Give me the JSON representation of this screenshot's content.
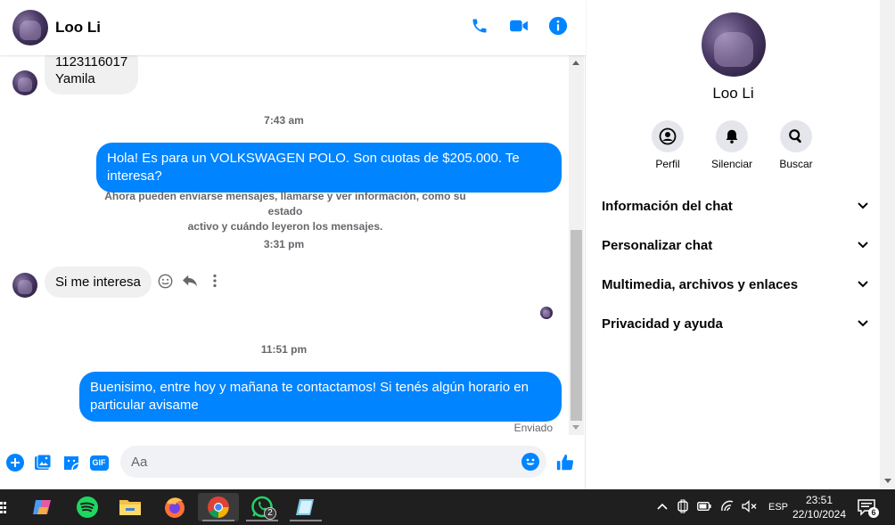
{
  "contact": {
    "name": "Loo Li"
  },
  "messages": {
    "incoming_top_line1": "1123116017",
    "incoming_top_line2": "Yamila",
    "ts1": "7:43 am",
    "outgoing1": "Hola! Es para un VOLKSWAGEN POLO. Son cuotas de $205.000. Te interesa?",
    "system_line1": "Ahora pueden enviarse mensajes, llamarse y ver información, como su estado",
    "system_line2": "activo y cuándo leyeron los mensajes.",
    "ts2": "3:31 pm",
    "incoming2": "Si me interesa",
    "ts3": "11:51 pm",
    "outgoing2_line1": "Buenisimo, entre hoy y mañana te contactamos! Si tenés algún horario en",
    "outgoing2_line2": "particular avisame",
    "status": "Enviado"
  },
  "composer": {
    "placeholder": "Aa",
    "gif_label": "GIF"
  },
  "panel": {
    "actions": [
      {
        "label": "Perfil",
        "icon": "profile-icon"
      },
      {
        "label": "Silenciar",
        "icon": "bell-icon"
      },
      {
        "label": "Buscar",
        "icon": "search-icon"
      }
    ],
    "sections": [
      "Información del chat",
      "Personalizar chat",
      "Multimedia, archivos y enlaces",
      "Privacidad y ayuda"
    ]
  },
  "taskbar": {
    "whatsapp_badge": "2",
    "lang": "ESP",
    "time": "23:51",
    "date": "22/10/2024",
    "notifications": "6"
  },
  "colors": {
    "accent": "#0084ff",
    "incoming_bubble": "#f0f0f0",
    "taskbar": "#1f1f1f"
  }
}
